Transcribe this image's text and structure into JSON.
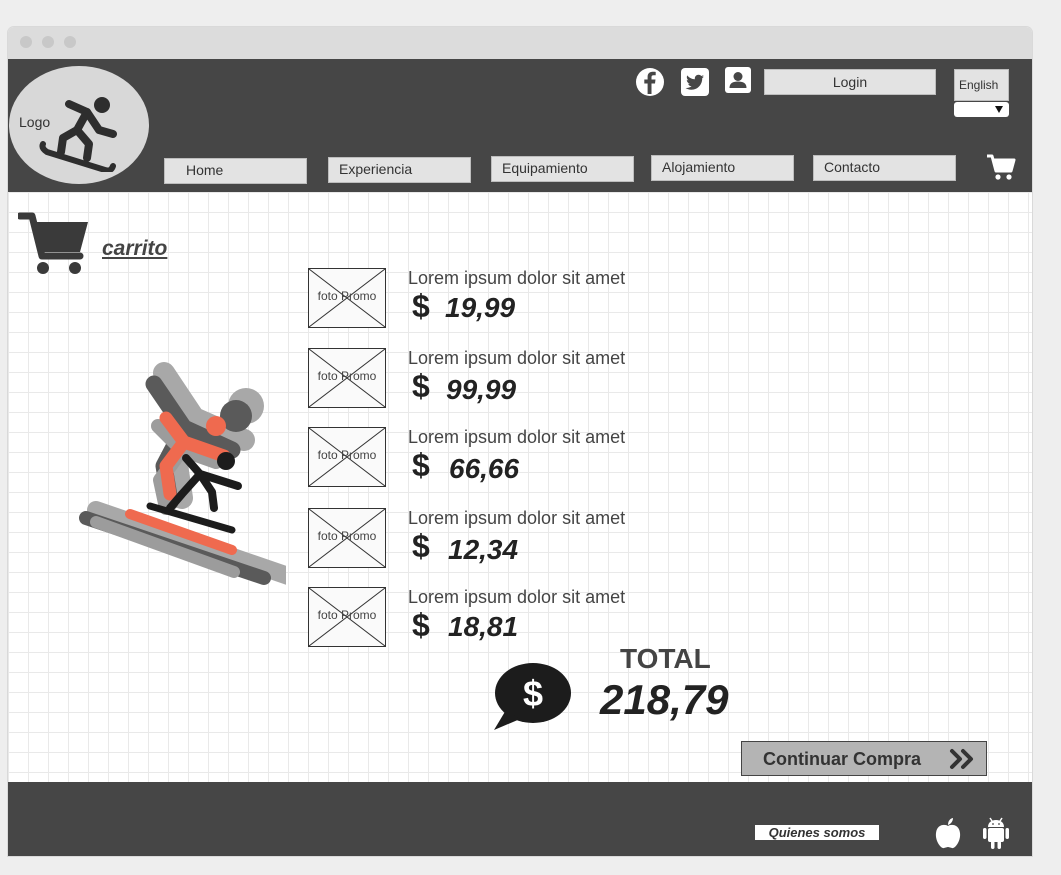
{
  "header": {
    "logo_text": "Logo",
    "login_label": "Login",
    "language_label": "English",
    "nav": [
      {
        "label": "Home"
      },
      {
        "label": "Experiencia"
      },
      {
        "label": "Equipamiento"
      },
      {
        "label": "Alojamiento"
      },
      {
        "label": "Contacto"
      }
    ],
    "icons": [
      "facebook-icon",
      "twitter-icon",
      "user-icon",
      "cart-icon"
    ]
  },
  "cart": {
    "title": "carrito",
    "items": [
      {
        "image_label": "foto Promo",
        "description": "Lorem ipsum dolor sit amet",
        "currency": "$",
        "price": "19,99"
      },
      {
        "image_label": "foto Promo",
        "description": "Lorem ipsum dolor sit amet",
        "currency": "$",
        "price": "99,99"
      },
      {
        "image_label": "foto Promo",
        "description": "Lorem ipsum dolor sit amet",
        "currency": "$",
        "price": "66,66"
      },
      {
        "image_label": "foto Promo",
        "description": "Lorem ipsum dolor sit amet",
        "currency": "$",
        "price": "12,34"
      },
      {
        "image_label": "foto Promo",
        "description": "Lorem ipsum dolor sit amet",
        "currency": "$",
        "price": "18,81"
      }
    ],
    "total_label": "TOTAL",
    "total_value": "218,79",
    "continue_label": "Continuar Compra"
  },
  "footer": {
    "about_label": "Quienes somos",
    "icons": [
      "apple-icon",
      "android-icon"
    ]
  },
  "colors": {
    "header_bg": "#464646",
    "accent": "#ef6a4f",
    "button_gray": "#b4b4b4"
  }
}
